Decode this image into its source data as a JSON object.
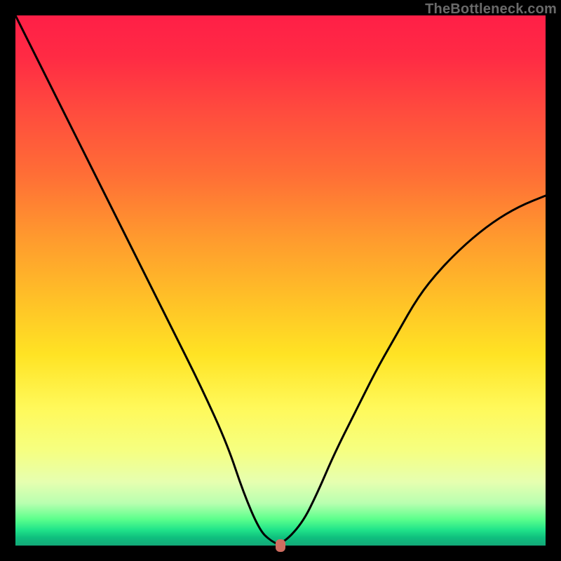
{
  "watermark": "TheBottleneck.com",
  "chart_data": {
    "type": "line",
    "title": "",
    "xlabel": "",
    "ylabel": "",
    "xlim": [
      0,
      100
    ],
    "ylim": [
      0,
      100
    ],
    "series": [
      {
        "name": "curve",
        "x": [
          0,
          5,
          10,
          15,
          20,
          25,
          30,
          35,
          40,
          43,
          46,
          48,
          50,
          54,
          57,
          60,
          64,
          68,
          72,
          76,
          80,
          85,
          90,
          95,
          100
        ],
        "values": [
          100,
          90,
          80,
          70,
          60,
          50,
          40,
          30,
          19,
          10,
          3,
          1,
          0,
          4,
          10,
          17,
          25,
          33,
          40,
          47,
          52,
          57,
          61,
          64,
          66
        ]
      }
    ],
    "marker": {
      "x": 50,
      "y": 0
    },
    "background": "rainbow-vertical"
  }
}
